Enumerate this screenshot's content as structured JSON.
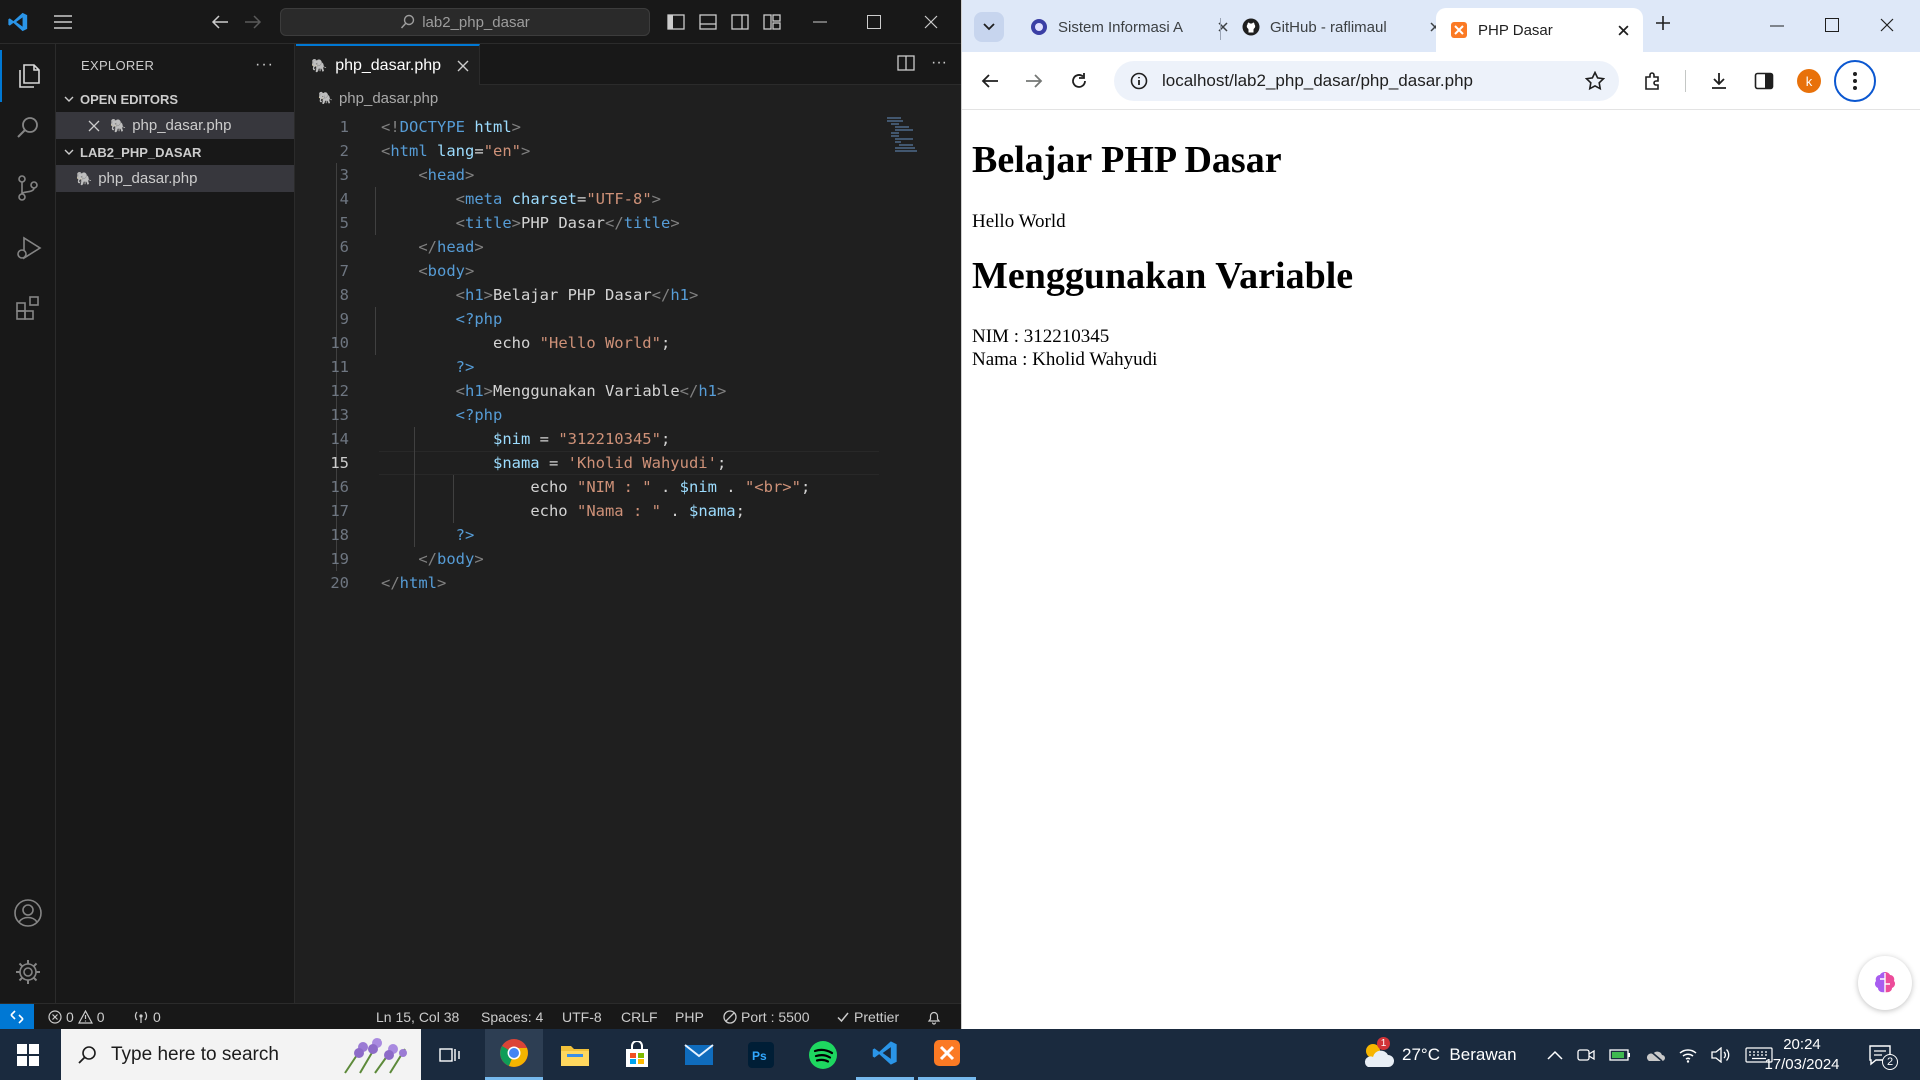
{
  "vscode": {
    "search_text": "lab2_php_dasar",
    "explorer": {
      "title": "EXPLORER",
      "open_editors_label": "OPEN EDITORS",
      "open_file": "php_dasar.php",
      "folder_label": "LAB2_PHP_DASAR",
      "folder_file": "php_dasar.php"
    },
    "tab_label": "php_dasar.php",
    "breadcrumb": "php_dasar.php",
    "current_line": 15,
    "status": {
      "errors": "0",
      "warnings": "0",
      "ports": "0",
      "cursor": "Ln 15, Col 38",
      "spaces": "Spaces: 4",
      "encoding": "UTF-8",
      "eol": "CRLF",
      "language": "PHP",
      "port": "Port : 5500",
      "prettier": "Prettier"
    },
    "code_lines": [
      [
        [
          "b",
          "<!"
        ],
        [
          "t",
          "DOCTYPE "
        ],
        [
          "a",
          "html"
        ],
        [
          "b",
          ">"
        ]
      ],
      [
        [
          "b",
          "<"
        ],
        [
          "t",
          "html "
        ],
        [
          "a",
          "lang"
        ],
        [
          "x",
          "="
        ],
        [
          "s",
          "\"en\""
        ],
        [
          "b",
          ">"
        ]
      ],
      [
        [
          "i",
          "    "
        ],
        [
          "b",
          "<"
        ],
        [
          "t",
          "head"
        ],
        [
          "b",
          ">"
        ]
      ],
      [
        [
          "i",
          "        "
        ],
        [
          "b",
          "<"
        ],
        [
          "t",
          "meta "
        ],
        [
          "a",
          "charset"
        ],
        [
          "x",
          "="
        ],
        [
          "s",
          "\"UTF-8\""
        ],
        [
          "b",
          ">"
        ]
      ],
      [
        [
          "i",
          "        "
        ],
        [
          "b",
          "<"
        ],
        [
          "t",
          "title"
        ],
        [
          "b",
          ">"
        ],
        [
          "x",
          "PHP Dasar"
        ],
        [
          "b",
          "</"
        ],
        [
          "t",
          "title"
        ],
        [
          "b",
          ">"
        ]
      ],
      [
        [
          "i",
          "    "
        ],
        [
          "b",
          "</"
        ],
        [
          "t",
          "head"
        ],
        [
          "b",
          ">"
        ]
      ],
      [
        [
          "i",
          "    "
        ],
        [
          "b",
          "<"
        ],
        [
          "t",
          "body"
        ],
        [
          "b",
          ">"
        ]
      ],
      [
        [
          "i",
          "        "
        ],
        [
          "b",
          "<"
        ],
        [
          "t",
          "h1"
        ],
        [
          "b",
          ">"
        ],
        [
          "x",
          "Belajar PHP Dasar"
        ],
        [
          "b",
          "</"
        ],
        [
          "t",
          "h1"
        ],
        [
          "b",
          ">"
        ]
      ],
      [
        [
          "i",
          "        "
        ],
        [
          "t",
          "<?php"
        ]
      ],
      [
        [
          "i",
          "            "
        ],
        [
          "x",
          "echo "
        ],
        [
          "s",
          "\"Hello World\""
        ],
        [
          "x",
          ";"
        ]
      ],
      [
        [
          "i",
          "        "
        ],
        [
          "t",
          "?>"
        ]
      ],
      [
        [
          "i",
          "        "
        ],
        [
          "b",
          "<"
        ],
        [
          "t",
          "h1"
        ],
        [
          "b",
          ">"
        ],
        [
          "x",
          "Menggunakan Variable"
        ],
        [
          "b",
          "</"
        ],
        [
          "t",
          "h1"
        ],
        [
          "b",
          ">"
        ]
      ],
      [
        [
          "i",
          "        "
        ],
        [
          "t",
          "<?php"
        ]
      ],
      [
        [
          "i",
          "            "
        ],
        [
          "a",
          "$nim"
        ],
        [
          "x",
          " = "
        ],
        [
          "s",
          "\"312210345\""
        ],
        [
          "x",
          ";"
        ]
      ],
      [
        [
          "i",
          "            "
        ],
        [
          "a",
          "$nama"
        ],
        [
          "x",
          " = "
        ],
        [
          "s",
          "'Kholid Wahyudi'"
        ],
        [
          "x",
          ";"
        ]
      ],
      [
        [
          "i",
          "                "
        ],
        [
          "x",
          "echo "
        ],
        [
          "s",
          "\"NIM : \""
        ],
        [
          "x",
          " . "
        ],
        [
          "a",
          "$nim"
        ],
        [
          "x",
          " . "
        ],
        [
          "s",
          "\"<br>\""
        ],
        [
          "x",
          ";"
        ]
      ],
      [
        [
          "i",
          "                "
        ],
        [
          "x",
          "echo "
        ],
        [
          "s",
          "\"Nama : \""
        ],
        [
          "x",
          " . "
        ],
        [
          "a",
          "$nama"
        ],
        [
          "x",
          ";"
        ]
      ],
      [
        [
          "i",
          "        "
        ],
        [
          "t",
          "?>"
        ]
      ],
      [
        [
          "i",
          "    "
        ],
        [
          "b",
          "</"
        ],
        [
          "t",
          "body"
        ],
        [
          "b",
          ">"
        ]
      ],
      [
        [
          "b",
          "</"
        ],
        [
          "t",
          "html"
        ],
        [
          "b",
          ">"
        ]
      ]
    ]
  },
  "chrome": {
    "tabs": [
      {
        "title": "Sistem Informasi A"
      },
      {
        "title": "GitHub - raflimaul"
      },
      {
        "title": "PHP Dasar"
      }
    ],
    "url": "localhost/lab2_php_dasar/php_dasar.php",
    "profile_initial": "k",
    "page": {
      "h1_a": "Belajar PHP Dasar",
      "p_a": "Hello World",
      "h1_b": "Menggunakan Variable",
      "line_nim": "NIM : 312210345",
      "line_nama": "Nama : Kholid Wahyudi"
    }
  },
  "taskbar": {
    "search_placeholder": "Type here to search",
    "weather": "27°C  Berawan",
    "weather_badge": "1",
    "time": "20:24",
    "date": "17/03/2024",
    "notif_count": "2"
  },
  "colors": {
    "vscode_accent": "#0078d4",
    "php_icon": "#a074c4",
    "chrome_tab_bg": "#dee8f8",
    "profile": "#e8710a"
  }
}
